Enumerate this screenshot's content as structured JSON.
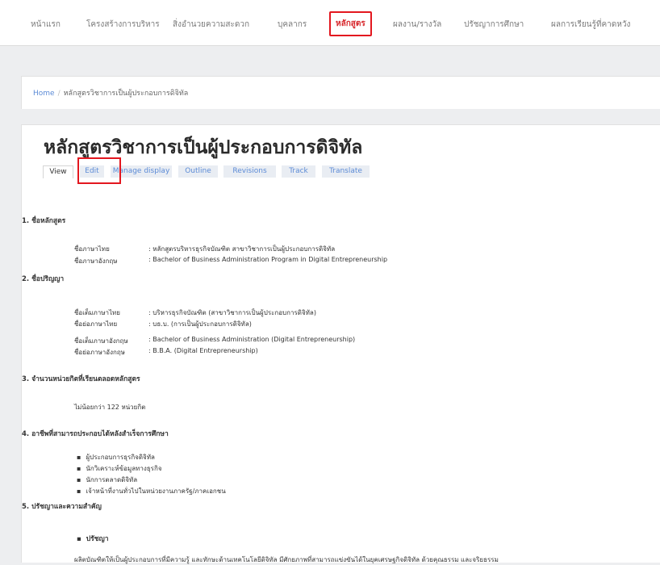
{
  "nav": {
    "items": [
      "หน้าแรก",
      "โครงสร้างการบริหาร",
      "สิ่งอำนวยความสะดวก",
      "บุคลากร",
      "หลักสูตร",
      "ผลงาน/รางวัล",
      "ปรัชญาการศึกษา",
      "ผลการเรียนรู้ที่คาดหวัง"
    ],
    "active": "หลักสูตร"
  },
  "breadcrumb": {
    "home": "Home",
    "separator": "/",
    "current": "หลักสูตรวิชาการเป็นผู้ประกอบการดิจิทัล"
  },
  "page": {
    "title": "หลักสูตรวิชาการเป็นผู้ประกอบการดิจิทัล",
    "tabs": [
      "View",
      "Edit",
      "Manage display",
      "Outline",
      "Revisions",
      "Track",
      "Translate"
    ],
    "active_tab": "View"
  },
  "sections": {
    "s1": {
      "heading": "1. ชื่อหลักสูตร",
      "rows": [
        {
          "label": "ชื่อภาษาไทย",
          "value": ": หลักสูตรบริหารธุรกิจบัณฑิต  สาขาวิชาการเป็นผู้ประกอบการดิจิทัล"
        },
        {
          "label": "ชื่อภาษาอังกฤษ",
          "value": ": Bachelor of Business Administration Program in Digital Entrepreneurship"
        }
      ]
    },
    "s2": {
      "heading": "2. ชื่อปริญญา",
      "rows": [
        {
          "label": "ชื่อเต็มภาษาไทย",
          "value": ": บริหารธุรกิจบัณฑิต (สาขาวิชาการเป็นผู้ประกอบการดิจิทัล)"
        },
        {
          "label": "ชื่อย่อภาษาไทย",
          "value": ": บธ.บ. (การเป็นผู้ประกอบการดิจิทัล)"
        },
        {
          "label": "ชื่อเต็มภาษาอังกฤษ",
          "value": ": Bachelor of Business Administration (Digital Entrepreneurship)"
        },
        {
          "label": "ชื่อย่อภาษาอังกฤษ",
          "value": ": B.B.A. (Digital Entrepreneurship)"
        }
      ]
    },
    "s3": {
      "heading": "3. จำนวนหน่วยกิตที่เรียนตลอดหลักสูตร",
      "text": "ไม่น้อยกว่า 122 หน่วยกิต"
    },
    "s4": {
      "heading": "4. อาชีพที่สามารถประกอบได้หลังสำเร็จการศึกษา",
      "items": [
        "ผู้ประกอบการธุรกิจดิจิทัล",
        "นักวิเคราะห์ข้อมูลทางธุรกิจ",
        "นักการตลาดดิจิทัล",
        "เจ้าหน้าที่งานทั่วไปในหน่วยงานภาครัฐ/ภาคเอกชน"
      ]
    },
    "s5": {
      "heading": "5. ปรัชญาและความสำคัญ",
      "sub": "ปรัชญา",
      "text": "ผลิตบัณฑิตให้เป็นผู้ประกอบการที่มีความรู้ และทักษะด้านเทคโนโลยีดิจิทัล มีศักยภาพที่สามารถแข่งขันได้ในยุคเศรษฐกิจดิจิทัล ด้วยคุณธรรม และจริยธรรม"
    }
  }
}
